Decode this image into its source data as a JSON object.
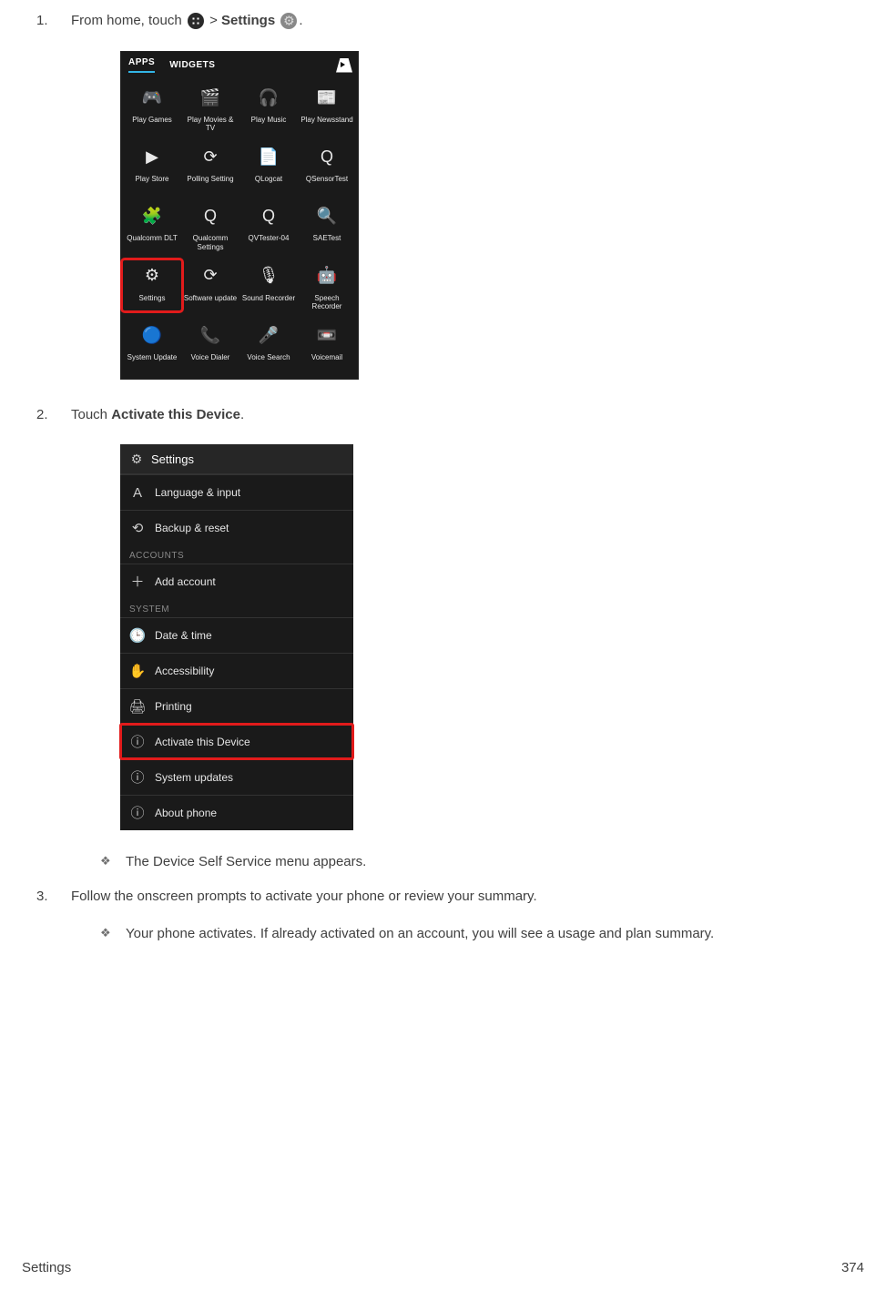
{
  "steps": {
    "s1": {
      "num": "1.",
      "t1": "From home, touch ",
      "gt": " > ",
      "settings": "Settings",
      "period": "."
    },
    "s2": {
      "num": "2.",
      "t1": "Touch ",
      "bold": "Activate this Device",
      "period": "."
    },
    "s2sub": "The Device Self Service menu appears.",
    "s3": {
      "num": "3.",
      "text": "Follow the onscreen prompts to activate your phone or review your summary."
    },
    "s3sub": "Your phone activates. If already activated on an account, you will see a usage and plan summary."
  },
  "shot1": {
    "tabs": {
      "apps": "APPS",
      "widgets": "WIDGETS"
    },
    "apps": [
      {
        "label": "Play Games",
        "glyph": "🎮"
      },
      {
        "label": "Play Movies & TV",
        "glyph": "🎬"
      },
      {
        "label": "Play Music",
        "glyph": "🎧"
      },
      {
        "label": "Play Newsstand",
        "glyph": "📰"
      },
      {
        "label": "Play Store",
        "glyph": "▶"
      },
      {
        "label": "Polling Setting",
        "glyph": "⟳"
      },
      {
        "label": "QLogcat",
        "glyph": "📄"
      },
      {
        "label": "QSensorTest",
        "glyph": "Q"
      },
      {
        "label": "Qualcomm DLT",
        "glyph": "🧩"
      },
      {
        "label": "Qualcomm Settings",
        "glyph": "Q"
      },
      {
        "label": "QVTester-04",
        "glyph": "Q"
      },
      {
        "label": "SAETest",
        "glyph": "🔍"
      },
      {
        "label": "Settings",
        "glyph": "⚙"
      },
      {
        "label": "Software update",
        "glyph": "⟳"
      },
      {
        "label": "Sound Recorder",
        "glyph": "🎙"
      },
      {
        "label": "Speech Recorder",
        "glyph": "🤖"
      },
      {
        "label": "System Update",
        "glyph": "🔵"
      },
      {
        "label": "Voice Dialer",
        "glyph": "📞"
      },
      {
        "label": "Voice Search",
        "glyph": "🎤"
      },
      {
        "label": "Voicemail",
        "glyph": "📼"
      }
    ]
  },
  "shot2": {
    "header": "Settings",
    "rows": {
      "lang": {
        "icon": "A",
        "label": "Language & input"
      },
      "backup": {
        "icon": "⟲",
        "label": "Backup & reset"
      },
      "accounts_h": "ACCOUNTS",
      "add": {
        "icon": "＋",
        "label": "Add account"
      },
      "system_h": "SYSTEM",
      "date": {
        "icon": "🕒",
        "label": "Date & time"
      },
      "access": {
        "icon": "✋",
        "label": "Accessibility"
      },
      "print": {
        "icon": "🖨",
        "label": "Printing"
      },
      "activate": {
        "icon": "ⓘ",
        "label": "Activate this Device"
      },
      "updates": {
        "icon": "ⓘ",
        "label": "System updates"
      },
      "about": {
        "icon": "ⓘ",
        "label": "About phone"
      }
    }
  },
  "footer": {
    "left": "Settings",
    "right": "374"
  }
}
